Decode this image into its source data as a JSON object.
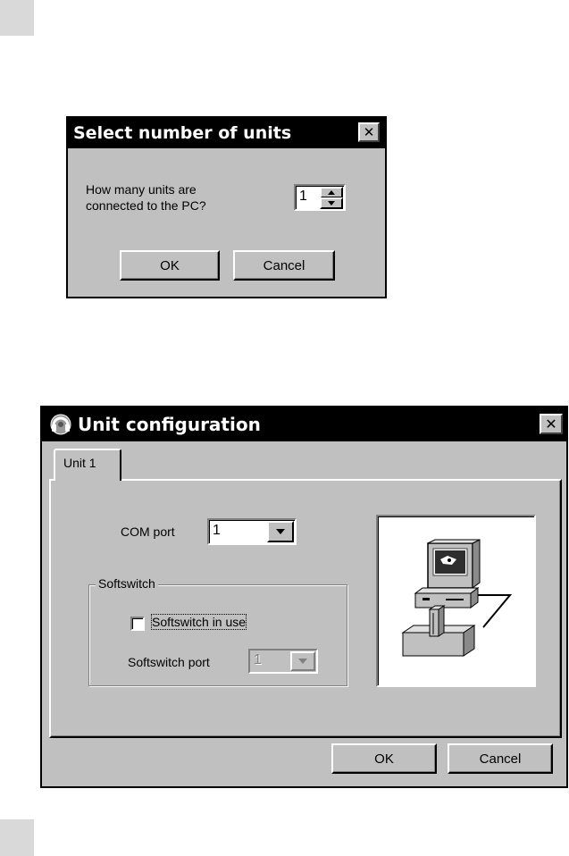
{
  "dialog_units": {
    "title": "Select number of units",
    "question_line1": "How many units are",
    "question_line2": "connected to the PC?",
    "spinner_value": "1",
    "ok_label": "OK",
    "cancel_label": "Cancel",
    "close_glyph": "✕"
  },
  "dialog_config": {
    "title": "Unit configuration",
    "close_glyph": "✕",
    "tab_label": "Unit 1",
    "com_port_label": "COM port",
    "com_port_value": "1",
    "softswitch_group_label": "Softswitch",
    "softswitch_checkbox_label": "Softswitch in use",
    "softswitch_checked": false,
    "softswitch_port_label": "Softswitch port",
    "softswitch_port_value": "1",
    "ok_label": "OK",
    "cancel_label": "Cancel",
    "illustration_icon": "computer-with-unit-icon"
  }
}
